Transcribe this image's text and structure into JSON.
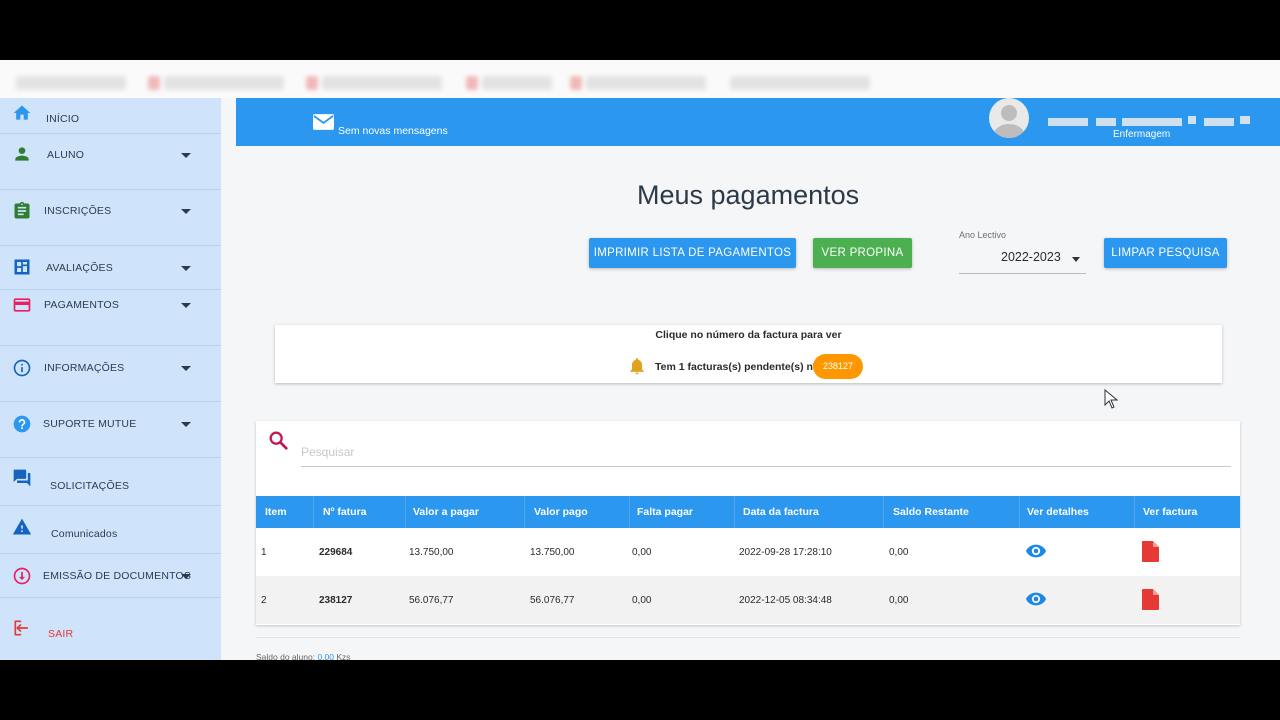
{
  "sidebar": {
    "items": [
      {
        "label": "INÍCIO",
        "icon": "home-icon"
      },
      {
        "label": "ALUNO",
        "icon": "person-icon"
      },
      {
        "label": "INSCRIÇÕES",
        "icon": "clipboard-icon"
      },
      {
        "label": "AVALIAÇÕES",
        "icon": "dashboard-icon"
      },
      {
        "label": "PAGAMENTOS",
        "icon": "credit-card-icon"
      },
      {
        "label": "INFORMAÇÕES",
        "icon": "info-icon"
      },
      {
        "label": "SUPORTE MUTUE",
        "icon": "help-icon"
      },
      {
        "label": "SOLICITAÇÕES",
        "icon": "chat-icon"
      },
      {
        "label": "Comunicados",
        "icon": "warning-icon"
      },
      {
        "label": "EMISSÃO DE DOCUMENTOS",
        "icon": "download-icon"
      },
      {
        "label": "SAIR",
        "icon": "logout-icon"
      }
    ]
  },
  "header": {
    "messages_label": "Sem novas mensagens",
    "user_course": "Enfermagem"
  },
  "main": {
    "title": "Meus pagamentos",
    "print_button": "IMPRIMIR LISTA DE PAGAMENTOS",
    "propina_button": "VER PROPINA",
    "clear_button": "LIMPAR PESQUISA",
    "year_label": "Ano Lectivo",
    "year_value": "2022-2023",
    "info_hint": "Clique no número da factura para ver",
    "pending_text": "Tem 1 facturas(s) pendente(s) nº",
    "pending_number": "238127",
    "search_placeholder": "Pesquisar",
    "footer_label": "Saldo do aluno:",
    "footer_value": "0,00",
    "footer_unit": "Kzs"
  },
  "table": {
    "headers": [
      "Item",
      "Nº fatura",
      "Valor a pagar",
      "Valor pago",
      "Falta pagar",
      "Data da factura",
      "Saldo Restante",
      "Ver detalhes",
      "Ver factura"
    ],
    "rows": [
      {
        "item": "1",
        "fatura": "229684",
        "valor_pagar": "13.750,00",
        "valor_pago": "13.750,00",
        "falta": "0,00",
        "data": "2022-09-28 17:28:10",
        "saldo": "0,00"
      },
      {
        "item": "2",
        "fatura": "238127",
        "valor_pagar": "56.076,77",
        "valor_pago": "56.076,77",
        "falta": "0,00",
        "data": "2022-12-05 08:34:48",
        "saldo": "0,00"
      }
    ]
  },
  "colors": {
    "primary": "#2b97ee",
    "success": "#4caf50",
    "warning": "#ff9800",
    "sidebar": "#cfe4fb",
    "pdf": "#e53935",
    "logout": "#e53935"
  }
}
